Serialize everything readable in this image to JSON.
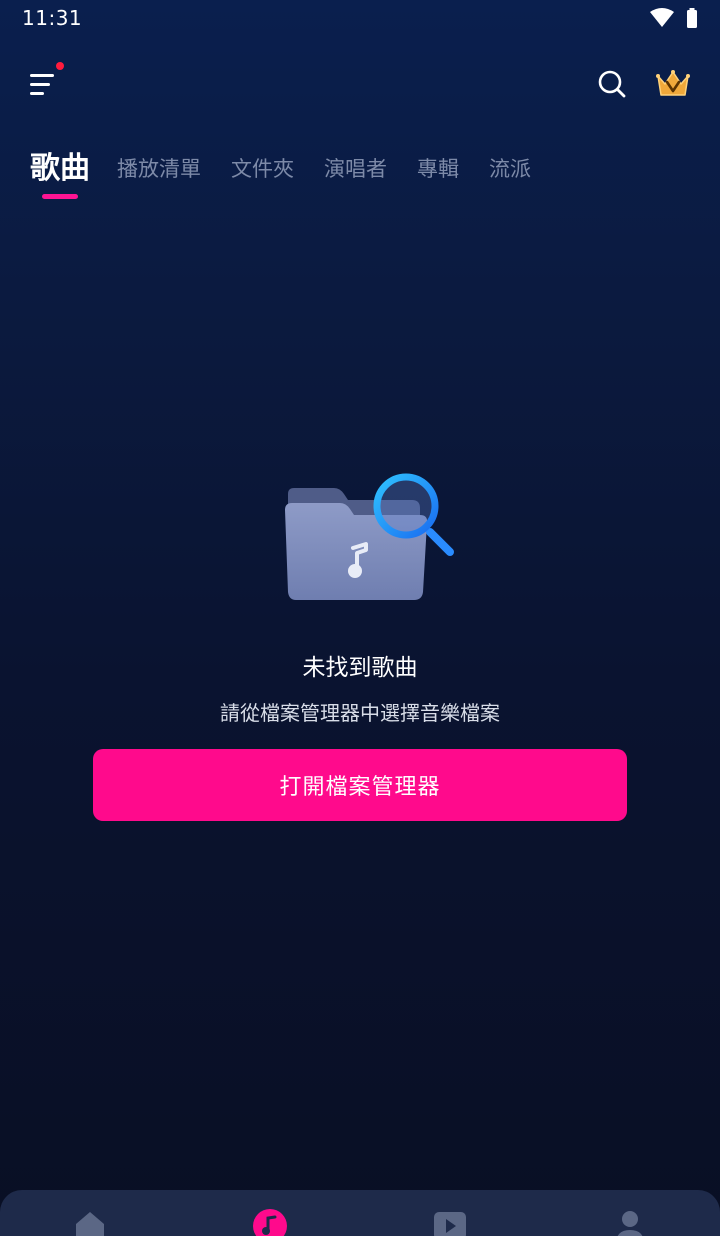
{
  "status_bar": {
    "time": "11:31",
    "icons": [
      "wifi-icon",
      "battery-icon"
    ]
  },
  "top_bar": {
    "icons": [
      "menu-icon",
      "search-icon",
      "crown-icon"
    ],
    "notification_dot_color": "#ff1b3d"
  },
  "tabs": {
    "items": [
      {
        "label": "歌曲",
        "active": true
      },
      {
        "label": "播放清單",
        "active": false
      },
      {
        "label": "文件夾",
        "active": false
      },
      {
        "label": "演唱者",
        "active": false
      },
      {
        "label": "專輯",
        "active": false
      },
      {
        "label": "流派",
        "active": false
      }
    ],
    "indicator_color": "#ff1493"
  },
  "empty_state": {
    "title": "未找到歌曲",
    "subtitle": "請從檔案管理器中選擇音樂檔案",
    "button_label": "打開檔案管理器",
    "icon": "folder-music-search-icon"
  },
  "bottom_nav": {
    "items": [
      "home-icon",
      "music-icon",
      "video-icon",
      "profile-icon"
    ],
    "active_index": 1
  },
  "colors": {
    "accent": "#ff0a8c",
    "background": "#0a1a3e",
    "tab_inactive": "#7d8aa8"
  }
}
